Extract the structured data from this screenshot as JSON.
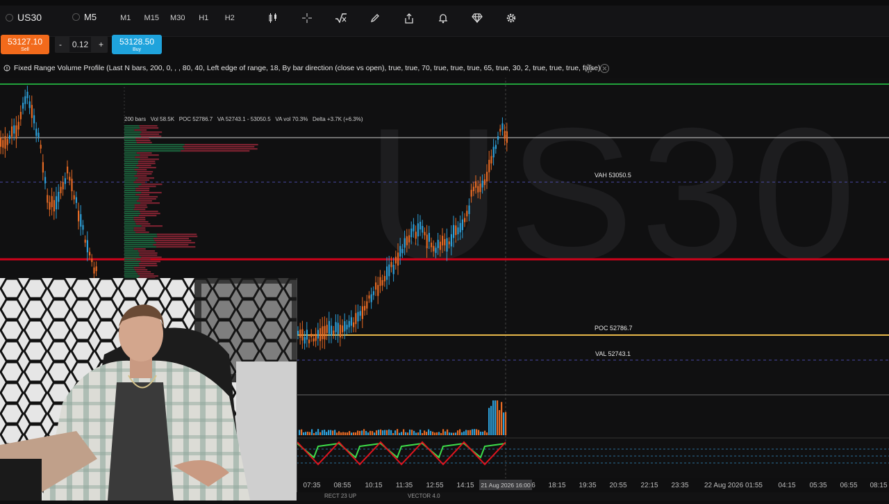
{
  "toolbar": {
    "symbol": "US30",
    "timeframe_selected": "M5",
    "timeframes": [
      "M1",
      "M15",
      "M30",
      "H1",
      "H2"
    ],
    "tool_icons": [
      "candle-settings-icon",
      "crosshair-icon",
      "indicators-icon",
      "draw-pencil-icon",
      "share-icon",
      "alert-bell-icon",
      "premium-diamond-icon",
      "settings-gear-icon"
    ]
  },
  "order": {
    "sell_price": "53127.10",
    "sell_label": "Sell",
    "buy_price": "53128.50",
    "buy_label": "Buy",
    "minus": "-",
    "plus": "+",
    "quantity": "0.12"
  },
  "indicator": {
    "title": "Fixed Range Volume Profile (Last N bars, 200, 0, , , 80, 40, Left edge of range, 18, By bar direction (close vs open), true, true, 70, true, true, true, 65, true, 30, 2, true, true, true, false)",
    "stats": "200 bars   Vol 58.5K   POC 52786.7   VA 52743.1 - 53050.5   VA vol 70.3%   Delta +3.7K (+6.3%)"
  },
  "chart": {
    "watermark": "US30",
    "vah_label": "VAH 53050.5",
    "poc_label": "POC 52786.7",
    "val_label": "VAL 52743.1",
    "crosshair_time": "21 Aug 2026 16:00",
    "x_labels": [
      "07:35",
      "08:55",
      "10:15",
      "11:35",
      "12:55",
      "14:15",
      "6",
      "18:15",
      "19:35",
      "20:55",
      "22:15",
      "23:35",
      "22 Aug 2026 01:55",
      "04:15",
      "05:35",
      "06:55",
      "08:15"
    ],
    "colors": {
      "up": "#2d9fd8",
      "down": "#e66a24",
      "support": "#d0021b",
      "resistance": "#21a33b",
      "poc": "#e8b84a",
      "va": "#4a4aa8"
    }
  },
  "bottom": {
    "tab1": "RECT 23 UP",
    "tab2": "VECTOR 4.0"
  }
}
